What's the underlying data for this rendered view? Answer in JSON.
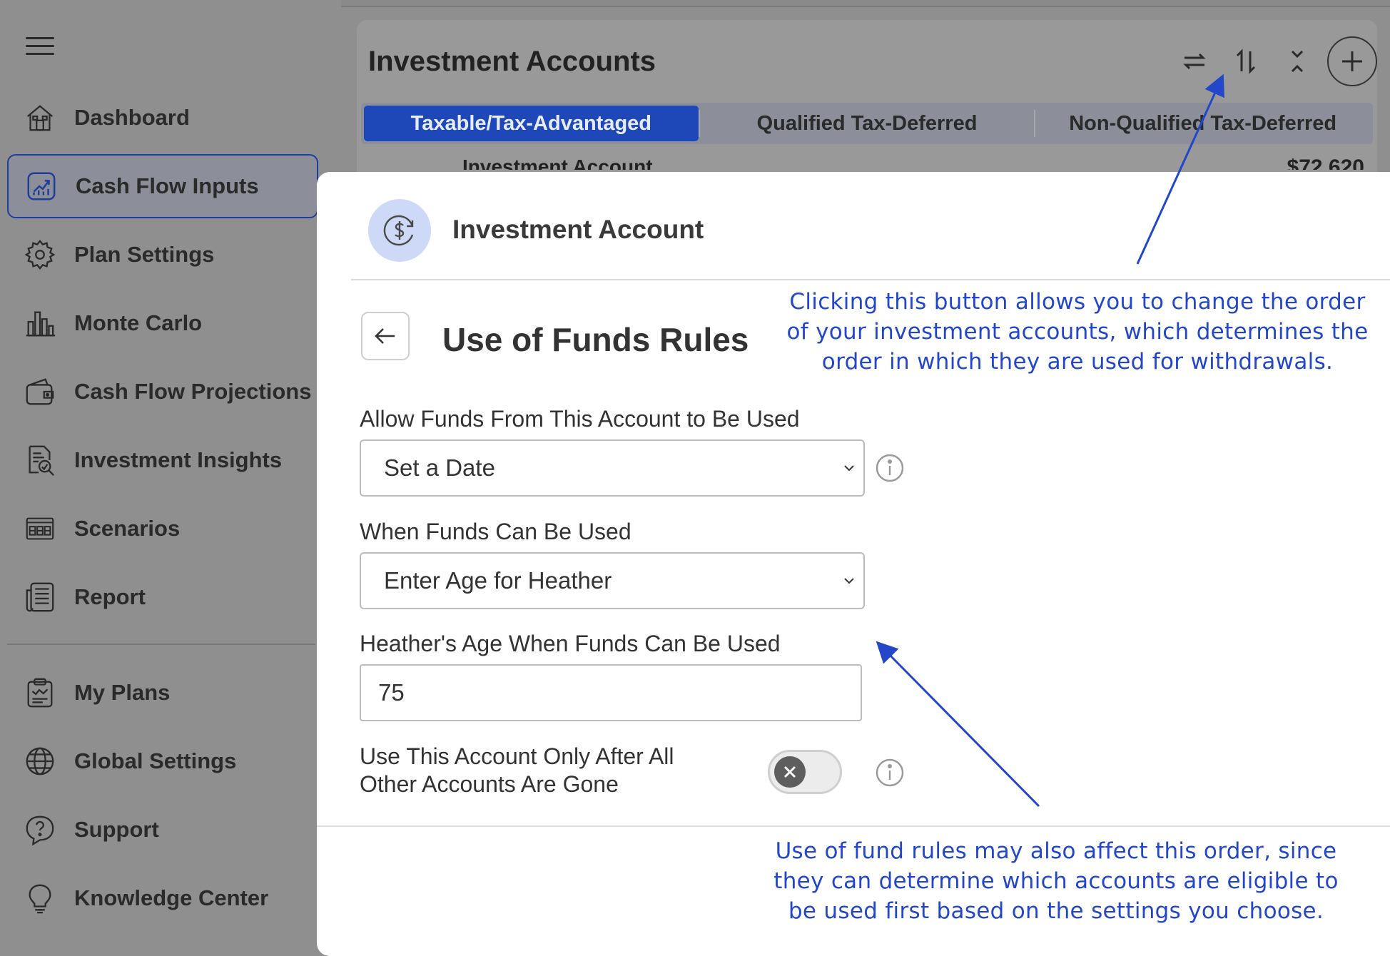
{
  "sidebar": {
    "items": [
      {
        "label": "Dashboard",
        "icon": "home-icon"
      },
      {
        "label": "Cash Flow Inputs",
        "icon": "chart-up-icon",
        "active": true
      },
      {
        "label": "Plan Settings",
        "icon": "gear-icon"
      },
      {
        "label": "Monte Carlo",
        "icon": "bar-chart-icon"
      },
      {
        "label": "Cash Flow Projections",
        "icon": "wallet-icon"
      },
      {
        "label": "Investment Insights",
        "icon": "document-search-icon"
      },
      {
        "label": "Scenarios",
        "icon": "scenarios-icon"
      },
      {
        "label": "Report",
        "icon": "report-icon"
      },
      {
        "label": "My Plans",
        "icon": "clipboard-icon"
      },
      {
        "label": "Global Settings",
        "icon": "globe-icon"
      },
      {
        "label": "Support",
        "icon": "help-bubble-icon"
      },
      {
        "label": "Knowledge Center",
        "icon": "lightbulb-icon"
      }
    ]
  },
  "panel": {
    "title": "Investment Accounts",
    "tabs": [
      {
        "label": "Taxable/Tax-Advantaged",
        "active": true
      },
      {
        "label": "Qualified Tax-Deferred"
      },
      {
        "label": "Non-Qualified Tax-Deferred"
      }
    ],
    "first_row_label": "Investment Account",
    "first_row_value": "$72,620"
  },
  "modal": {
    "title": "Investment Account",
    "section_title": "Use of Funds Rules",
    "allow_funds": {
      "label": "Allow Funds From This Account to Be Used",
      "value": "Set a Date"
    },
    "when_funds": {
      "label": "When Funds Can Be Used",
      "value": "Enter Age for Heather"
    },
    "age_field": {
      "label": "Heather's Age When Funds Can Be Used",
      "value": "75"
    },
    "toggle": {
      "label": "Use This Account Only After All Other Accounts Are Gone",
      "state": "off"
    }
  },
  "annotations": {
    "top": "Clicking this button allows you to change the order of your investment accounts, which determines the order in which they are used for withdrawals.",
    "bottom": "Use of fund rules may also affect this order, since they can determine which accounts are eligible to be used first based on the settings you choose."
  },
  "colors": {
    "accent": "#1e47b8",
    "annotation": "#2347c8",
    "overlay": "#8f8f8f",
    "avatar_bg": "#cdd9f6"
  }
}
